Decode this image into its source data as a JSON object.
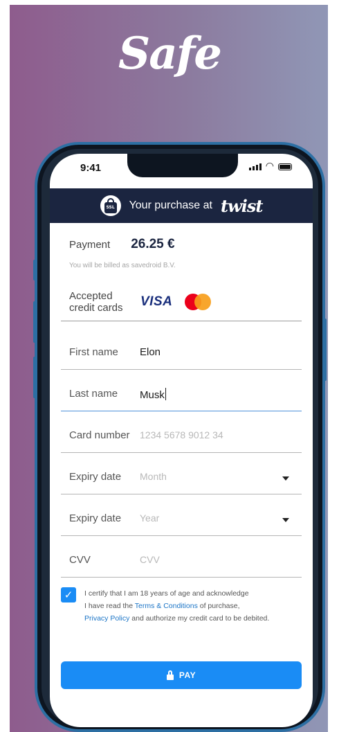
{
  "brand": {
    "logo_text": "Safe"
  },
  "status_bar": {
    "time": "9:41"
  },
  "header": {
    "text": "Your purchase at",
    "merchant_logo": "twist"
  },
  "payment": {
    "label": "Payment",
    "amount": "26.25 €",
    "billed_note": "You will be billed as savedroid B.V."
  },
  "accepted_cards": {
    "label_line1": "Accepted",
    "label_line2": "credit cards",
    "visa": "VISA"
  },
  "form": {
    "first_name": {
      "label": "First name",
      "value": "Elon"
    },
    "last_name": {
      "label": "Last name",
      "value": "Musk"
    },
    "card_number": {
      "label": "Card number",
      "placeholder": "1234 5678 9012 34"
    },
    "expiry_month": {
      "label": "Expiry date",
      "placeholder": "Month"
    },
    "expiry_year": {
      "label": "Expiry date",
      "placeholder": "Year"
    },
    "cvv": {
      "label": "CVV",
      "placeholder": "CVV"
    }
  },
  "consent": {
    "checked": true,
    "line1": "I certify that I am 18 years of age and acknowledge",
    "line2_pre": "I have read the ",
    "terms_link": "Terms & Conditions",
    "line2_post": " of purchase,",
    "privacy_link": "Privacy Policy",
    "line3_post": " and authorize my credit card to be debited."
  },
  "pay_button": {
    "label": "PAY"
  },
  "colors": {
    "header_bg": "#1b2540",
    "accent": "#1a8cf5",
    "bg_left": "#8e5c8d",
    "bg_right": "#9097b6"
  }
}
